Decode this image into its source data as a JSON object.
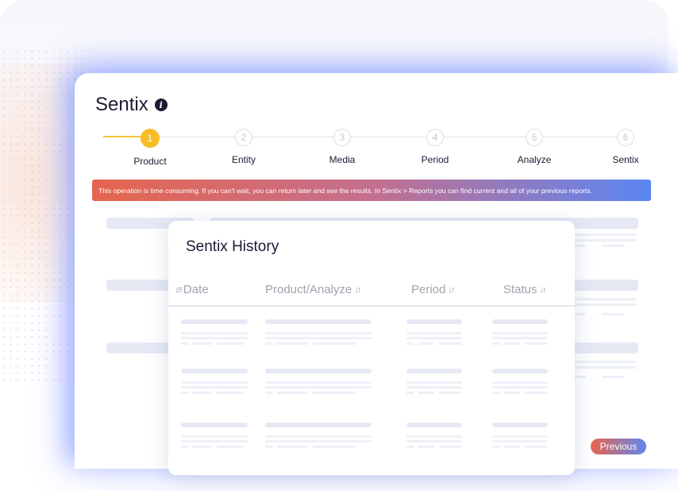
{
  "app": {
    "title": "Sentix"
  },
  "stepper": {
    "steps": [
      {
        "number": "1",
        "label": "Product",
        "active": true
      },
      {
        "number": "2",
        "label": "Entity",
        "active": false
      },
      {
        "number": "3",
        "label": "Media",
        "active": false
      },
      {
        "number": "4",
        "label": "Period",
        "active": false
      },
      {
        "number": "5",
        "label": "Analyze",
        "active": false
      },
      {
        "number": "6",
        "label": "Sentix",
        "active": false
      }
    ]
  },
  "banner": {
    "text": "This operation is time consuming. If you can't wait, you can return later and see the results. In Sentix > Reports you can find current and all of your previous reports."
  },
  "history": {
    "title": "Sentix History",
    "columns": [
      {
        "label": "Date",
        "sort_icon": "sort-desc-icon"
      },
      {
        "label": "Product/Analyze",
        "sort_icon": "sort-icon"
      },
      {
        "label": "Period",
        "sort_icon": "sort-icon"
      },
      {
        "label": "Status",
        "sort_icon": "sort-icon"
      }
    ]
  },
  "footer": {
    "previous_label": "Previous"
  },
  "colors": {
    "accent_yellow": "#f6bd25",
    "banner_start": "#e5654d",
    "banner_end": "#5a86f2",
    "text_dark": "#1b1a33",
    "muted": "#a2a2ae"
  }
}
